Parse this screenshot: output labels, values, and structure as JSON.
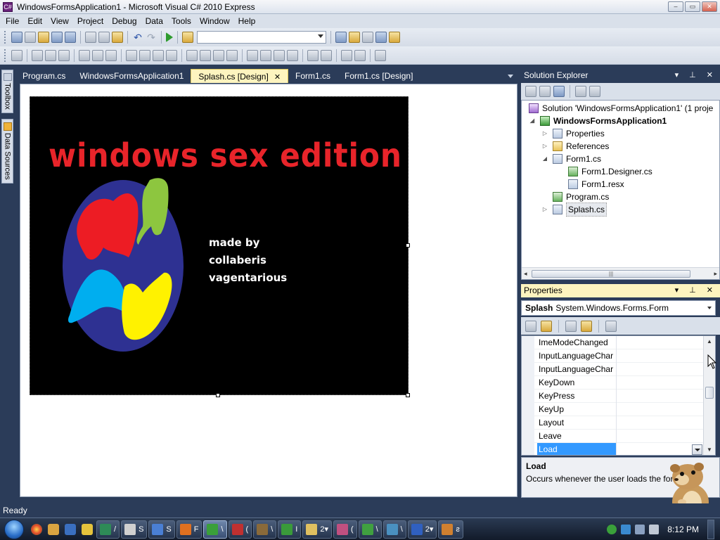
{
  "window": {
    "title": "WindowsFormsApplication1 - Microsoft Visual C# 2010 Express",
    "icon": "visual-csharp-icon",
    "controls": {
      "minimize": "–",
      "maximize": "▭",
      "close": "✕"
    }
  },
  "menu": [
    "File",
    "Edit",
    "View",
    "Project",
    "Debug",
    "Data",
    "Tools",
    "Window",
    "Help"
  ],
  "toolbar": {
    "solution_config_value": ""
  },
  "side_tabs": {
    "toolbox": "Toolbox",
    "data_sources": "Data Sources"
  },
  "doc_tabs": [
    {
      "label": "Program.cs",
      "active": false
    },
    {
      "label": "WindowsFormsApplication1",
      "active": false
    },
    {
      "label": "Splash.cs [Design]",
      "active": true,
      "close": "✕"
    },
    {
      "label": "Form1.cs",
      "active": false
    },
    {
      "label": "Form1.cs [Design]",
      "active": false
    }
  ],
  "splash": {
    "title": "windows sex edition",
    "credits": [
      "made by",
      "collaberis",
      "vagentarious"
    ],
    "colors": {
      "background": "#000000",
      "title": "#e8242a",
      "globe": "#2e3192",
      "red": "#ed1c24",
      "green": "#8dc63f",
      "cyan": "#00aeef",
      "yellow": "#fff200"
    }
  },
  "solution_explorer": {
    "title": "Solution Explorer",
    "header_icons": "▾ ⊥ ✕",
    "tree": [
      {
        "label": "Solution 'WindowsFormsApplication1' (1 proje",
        "icon": "solution-icon",
        "expander": "",
        "bold": false
      },
      {
        "label": "WindowsFormsApplication1",
        "icon": "csharp-project-icon",
        "expander": "◢",
        "bold": true
      },
      {
        "label": "Properties",
        "icon": "properties-folder-icon",
        "expander": "▷",
        "bold": false
      },
      {
        "label": "References",
        "icon": "references-icon",
        "expander": "▷",
        "bold": false
      },
      {
        "label": "Form1.cs",
        "icon": "form-icon",
        "expander": "◢",
        "bold": false
      },
      {
        "label": "Form1.Designer.cs",
        "icon": "csharp-file-icon",
        "expander": "",
        "bold": false
      },
      {
        "label": "Form1.resx",
        "icon": "resx-file-icon",
        "expander": "",
        "bold": false
      },
      {
        "label": "Program.cs",
        "icon": "csharp-file-icon",
        "expander": "",
        "bold": false
      },
      {
        "label": "Splash.cs",
        "icon": "form-icon",
        "expander": "▷",
        "bold": false
      }
    ],
    "scroll_thumb": "|||"
  },
  "properties": {
    "title": "Properties",
    "header_icons": "▾ ⊥ ✕",
    "object_name": "Splash",
    "object_type": "System.Windows.Forms.Form",
    "rows": [
      {
        "name": "ImeModeChanged",
        "value": ""
      },
      {
        "name": "InputLanguageChar",
        "value": ""
      },
      {
        "name": "InputLanguageChar",
        "value": ""
      },
      {
        "name": "KeyDown",
        "value": ""
      },
      {
        "name": "KeyPress",
        "value": ""
      },
      {
        "name": "KeyUp",
        "value": ""
      },
      {
        "name": "Layout",
        "value": ""
      },
      {
        "name": "Leave",
        "value": ""
      },
      {
        "name": "Load",
        "value": ""
      }
    ],
    "selected_row": "Load",
    "description_title": "Load",
    "description_text": "Occurs whenever the user loads the form."
  },
  "status": {
    "text": "Ready"
  },
  "taskbar": {
    "buttons": [
      {
        "label": "/",
        "color": "#2e8b57"
      },
      {
        "label": "S",
        "color": "#d0d0d0"
      },
      {
        "label": "S",
        "color": "#4a7fd4"
      },
      {
        "label": "F",
        "color": "#e07020"
      },
      {
        "label": "\\",
        "color": "#3aa03a",
        "active": true
      },
      {
        "label": "(",
        "color": "#c03030"
      },
      {
        "label": "\\",
        "color": "#8a6a3a"
      },
      {
        "label": "I",
        "color": "#3a9a3a"
      },
      {
        "label": "2▾",
        "color": "#e0c060"
      },
      {
        "label": "(",
        "color": "#c05080"
      },
      {
        "label": "\\",
        "color": "#40a040"
      },
      {
        "label": "\\",
        "color": "#4a90c0"
      },
      {
        "label": "2▾",
        "color": "#3060c0"
      },
      {
        "label": "ƨ",
        "color": "#d08030"
      }
    ],
    "clock": "8:12 PM"
  }
}
